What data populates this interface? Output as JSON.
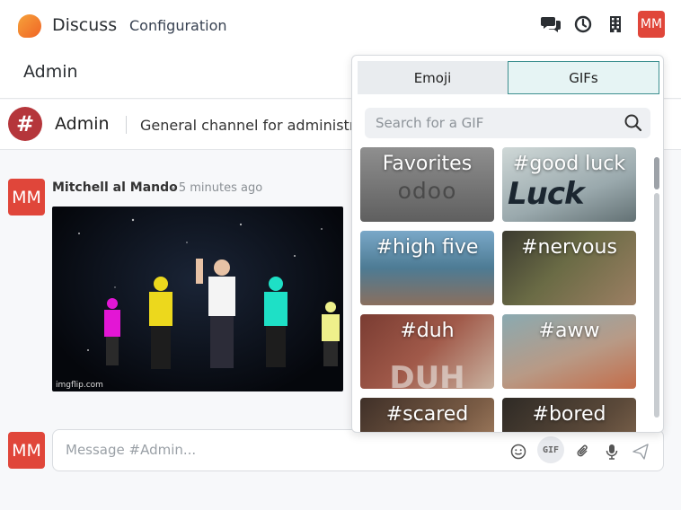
{
  "navbar": {
    "app_name": "Discuss",
    "menu_configuration": "Configuration",
    "user_initials": "MM",
    "icons": [
      "chat-icon",
      "clock-icon",
      "building-icon"
    ]
  },
  "breadcrumb": {
    "title": "Admin"
  },
  "channel": {
    "symbol": "#",
    "name": "Admin",
    "description": "General channel for administrato"
  },
  "message": {
    "avatar_initials": "MM",
    "author": "Mitchell al Mando",
    "time": "- 5 minutes ago",
    "gif_credit": "imgflip.com"
  },
  "composer": {
    "avatar_initials": "MM",
    "placeholder": "Message #Admin...",
    "gif_label": "GIF",
    "icons": [
      "emoji-icon",
      "gif-icon",
      "paperclip-icon",
      "microphone-icon",
      "send-icon"
    ]
  },
  "picker": {
    "tabs": [
      {
        "label": "Emoji",
        "active": false
      },
      {
        "label": "GIFs",
        "active": true
      }
    ],
    "search_placeholder": "Search for a GIF",
    "tiles": [
      {
        "label": "Favorites"
      },
      {
        "label": "#good luck"
      },
      {
        "label": "#high five"
      },
      {
        "label": "#nervous"
      },
      {
        "label": "#duh"
      },
      {
        "label": "#aww"
      },
      {
        "label": "#scared"
      },
      {
        "label": "#bored"
      }
    ]
  },
  "colors": {
    "avatar_red": "#e0463a",
    "channel_red": "#b5363b",
    "active_tab_border": "#3d8f8f"
  }
}
